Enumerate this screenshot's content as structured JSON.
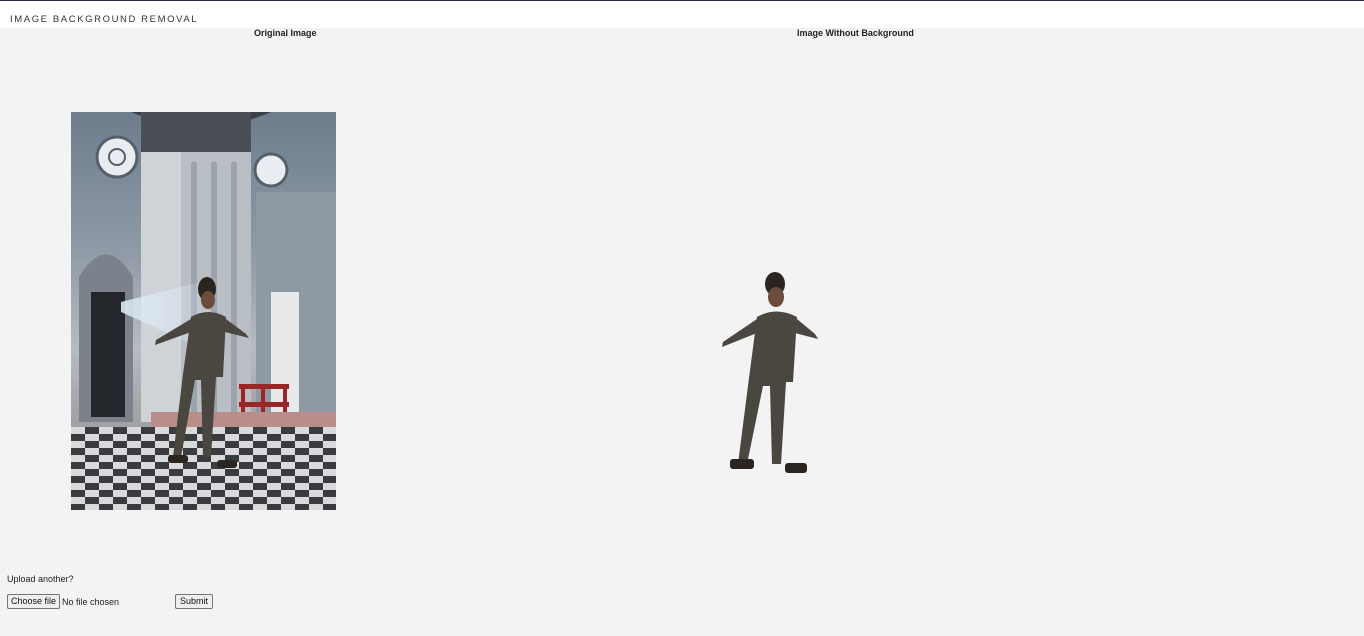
{
  "header": {
    "title": "IMAGE BACKGROUND REMOVAL"
  },
  "columns": {
    "original_label": "Original Image",
    "result_label": "Image Without Background"
  },
  "upload": {
    "prompt": "Upload another?",
    "choose_label": "Choose file",
    "file_status": "No file chosen",
    "submit_label": "Submit"
  },
  "colors": {
    "page_bg": "#f3f3f3",
    "header_bg": "#ffffff",
    "header_border": "#2a2a4a"
  },
  "images": {
    "original": "photo of a person standing in a church interior with a checkered floor",
    "result": "cutout of the same person with the background removed"
  }
}
